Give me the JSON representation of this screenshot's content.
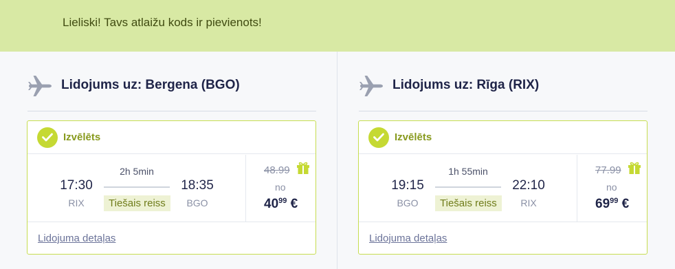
{
  "banner": {
    "message": "Lieliski! Tavs atlaižu kods ir pievienots!"
  },
  "colors": {
    "accent": "#c5d933",
    "banner_bg": "#d8e9a4",
    "card_border": "#c6dd4f"
  },
  "flights": [
    {
      "title": "Lidojums uz: Bergena (BGO)",
      "selected_label": "Izvēlēts",
      "depart_time": "17:30",
      "depart_code": "RIX",
      "duration": "2h 5min",
      "direct_label": "Tiešais reiss",
      "arrive_time": "18:35",
      "arrive_code": "BGO",
      "old_price": "48.99",
      "from_label": "no",
      "price_int": "40",
      "price_dec": "99",
      "currency": "€",
      "details_link": "Lidojuma detaļas"
    },
    {
      "title": "Lidojums uz: Rīga (RIX)",
      "selected_label": "Izvēlēts",
      "depart_time": "19:15",
      "depart_code": "BGO",
      "duration": "1h 55min",
      "direct_label": "Tiešais reiss",
      "arrive_time": "22:10",
      "arrive_code": "RIX",
      "old_price": "77.99",
      "from_label": "no",
      "price_int": "69",
      "price_dec": "99",
      "currency": "€",
      "details_link": "Lidojuma detaļas"
    }
  ],
  "icons": {
    "plane": "airplane-icon",
    "check": "checkmark-icon",
    "gift": "gift-icon"
  }
}
